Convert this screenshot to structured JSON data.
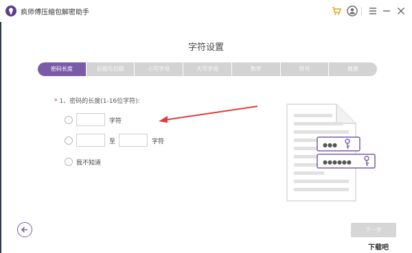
{
  "app": {
    "title": "疯师傅压缩包解密助手"
  },
  "dialog": {
    "title": "字符设置"
  },
  "steps": [
    {
      "label": "密码长度",
      "active": true
    },
    {
      "label": "前缀与后缀",
      "active": false
    },
    {
      "label": "小写字母",
      "active": false
    },
    {
      "label": "大写字母",
      "active": false
    },
    {
      "label": "数字",
      "active": false
    },
    {
      "label": "符号",
      "active": false
    },
    {
      "label": "概要",
      "active": false
    }
  ],
  "question": {
    "required_mark": "*",
    "text": "1、密码的长度(1-16位字符):"
  },
  "options": {
    "exact_unit": "字符",
    "range_to": "至",
    "range_unit": "字符",
    "unknown": "我不知道"
  },
  "buttons": {
    "next": "下一步"
  },
  "password_dots": {
    "short": "●●●",
    "long": "●●●●●●"
  },
  "watermark": "下载吧",
  "colors": {
    "accent": "#7a5ba8",
    "arrow": "#e23b3b",
    "step_inactive": "#d3d3d3"
  }
}
